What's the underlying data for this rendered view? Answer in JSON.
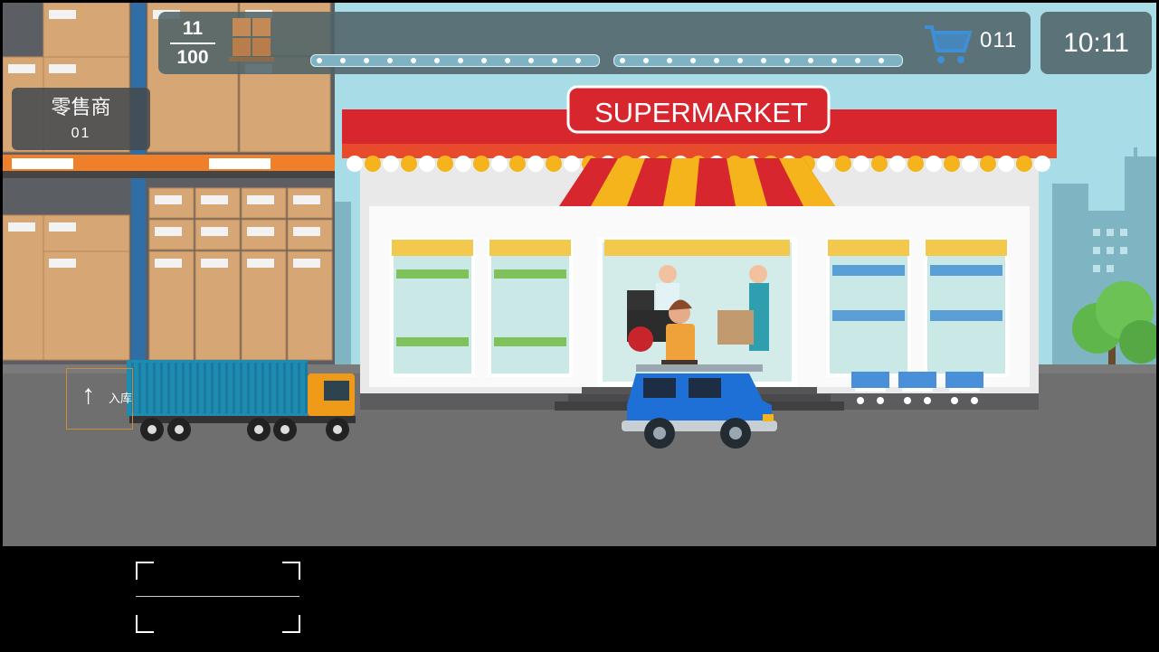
{
  "hud": {
    "progress_current": "11",
    "progress_total": "100",
    "cart_count": "011",
    "clock": "10:11"
  },
  "role": {
    "name": "零售商",
    "id": "01"
  },
  "enter_button": {
    "label": "入库"
  },
  "store": {
    "sign": "SUPERMARKET"
  },
  "icons": {
    "cart": "shopping-cart-icon",
    "pallet": "pallet-boxes-icon",
    "arrow": "arrow-up-icon"
  },
  "colors": {
    "awning_red": "#d7262e",
    "awning_yellow": "#f5b31c",
    "hud_bg": "#50646a",
    "truck_container": "#1e8bb0",
    "truck_cab": "#f09a1a",
    "car_blue": "#1e6fd6",
    "shelf_orange": "#f07f2a"
  }
}
